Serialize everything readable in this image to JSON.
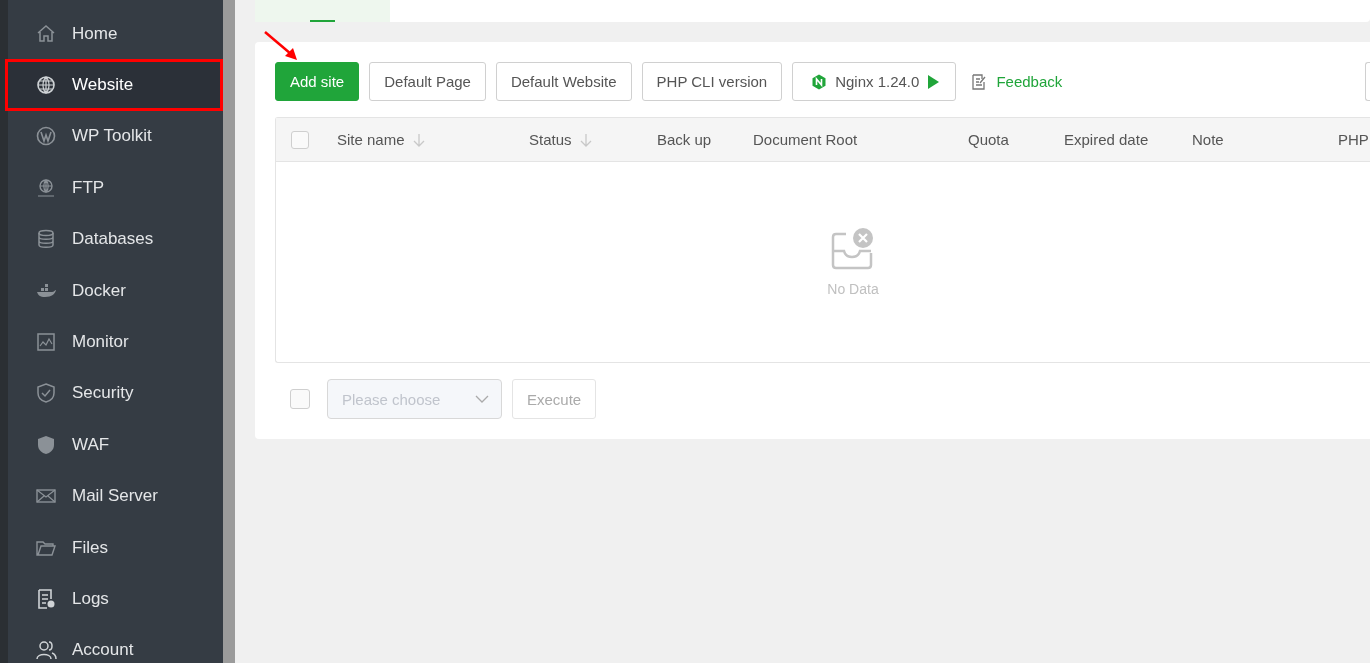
{
  "sidebar": {
    "items": [
      {
        "label": "Home",
        "selected": false,
        "annotated": false
      },
      {
        "label": "Website",
        "selected": true,
        "annotated": true
      },
      {
        "label": "WP Toolkit",
        "selected": false,
        "annotated": false
      },
      {
        "label": "FTP",
        "selected": false,
        "annotated": false
      },
      {
        "label": "Databases",
        "selected": false,
        "annotated": false
      },
      {
        "label": "Docker",
        "selected": false,
        "annotated": false
      },
      {
        "label": "Monitor",
        "selected": false,
        "annotated": false
      },
      {
        "label": "Security",
        "selected": false,
        "annotated": false
      },
      {
        "label": "WAF",
        "selected": false,
        "annotated": false
      },
      {
        "label": "Mail Server",
        "selected": false,
        "annotated": false
      },
      {
        "label": "Files",
        "selected": false,
        "annotated": false
      },
      {
        "label": "Logs",
        "selected": false,
        "annotated": false
      },
      {
        "label": "Account",
        "selected": false,
        "annotated": false
      }
    ]
  },
  "toolbar": {
    "buttons": [
      {
        "label": "Add site",
        "kind": "primary"
      },
      {
        "label": "Default Page",
        "kind": "default"
      },
      {
        "label": "Default Website",
        "kind": "default"
      },
      {
        "label": "PHP CLI version",
        "kind": "default"
      },
      {
        "label": "Nginx 1.24.0",
        "kind": "service"
      }
    ],
    "annotation_arrow": true,
    "feedback_link": "Feedback"
  },
  "table": {
    "select_all_checked": false,
    "columns": [
      {
        "label": "Site name",
        "sortable": true
      },
      {
        "label": "Status",
        "sortable": true
      },
      {
        "label": "Back up",
        "sortable": false
      },
      {
        "label": "Document Root",
        "sortable": false
      },
      {
        "label": "Quota",
        "sortable": false
      },
      {
        "label": "Expired date",
        "sortable": false
      },
      {
        "label": "Note",
        "sortable": false
      },
      {
        "label": "PHP",
        "sortable": false
      }
    ],
    "empty_text": "No Data"
  },
  "batch": {
    "checked": false,
    "select": {
      "placeholder": "Please choose",
      "disabled": true
    },
    "execute_button": {
      "label": "Execute",
      "disabled": true
    }
  }
}
